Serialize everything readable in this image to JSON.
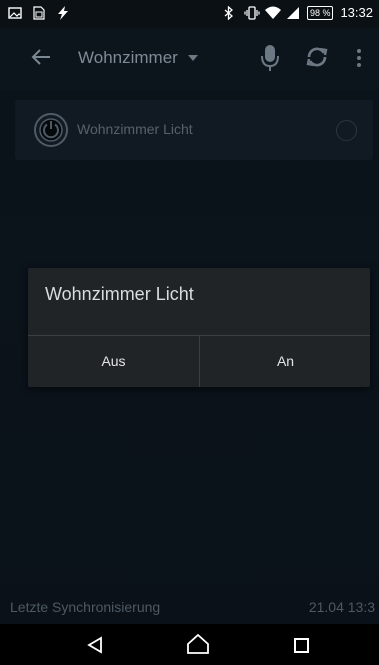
{
  "status_bar": {
    "icons_left": [
      "image-icon",
      "sim-icon",
      "flash-icon"
    ],
    "icons_right": [
      "bluetooth-icon",
      "vibrate-icon",
      "wifi-icon",
      "signal-icon"
    ],
    "battery": "98 %",
    "time": "13:32"
  },
  "app_bar": {
    "title": "Wohnzimmer",
    "icons": [
      "back-arrow-icon",
      "dropdown-caret-icon",
      "microphone-icon",
      "sync-icon",
      "more-vert-icon"
    ]
  },
  "device": {
    "label": "Wohnzimmer Licht",
    "icon": "power-icon"
  },
  "dialog": {
    "title": "Wohnzimmer Licht",
    "buttons": {
      "off": "Aus",
      "on": "An"
    }
  },
  "footer": {
    "sync_label": "Letzte Synchronisierung",
    "sync_time": "21.04 13:3"
  },
  "nav_bar": {
    "icons": [
      "nav-back-icon",
      "nav-home-icon",
      "nav-recent-icon"
    ]
  },
  "colors": {
    "background": "#0a1219",
    "dialog": "#202427"
  }
}
